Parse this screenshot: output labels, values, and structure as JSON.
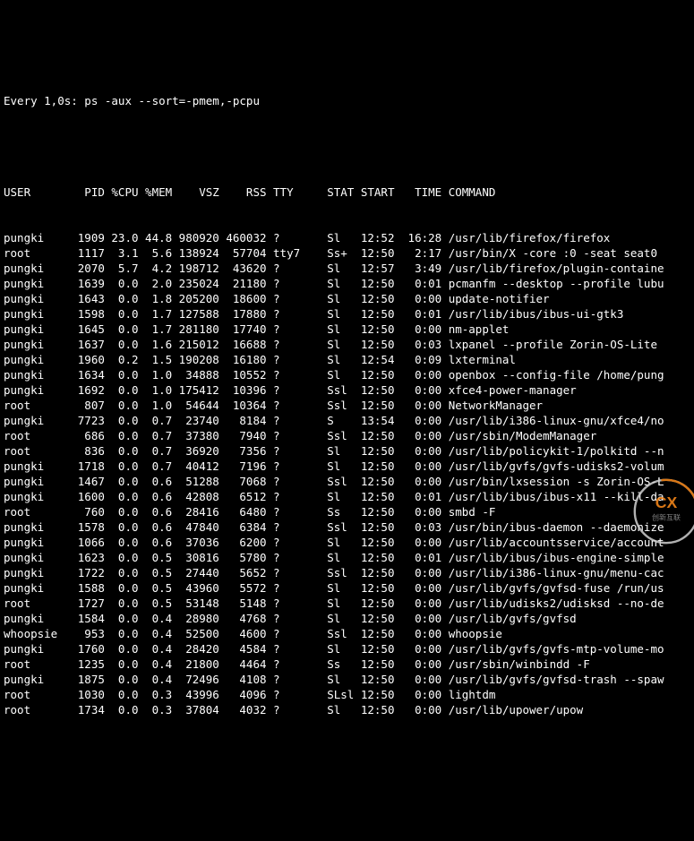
{
  "header_line": "Every 1,0s: ps -aux --sort=-pmem,-pcpu",
  "columns": [
    "USER",
    "PID",
    "%CPU",
    "%MEM",
    "VSZ",
    "RSS",
    "TTY",
    "STAT",
    "START",
    "TIME",
    "COMMAND"
  ],
  "rows": [
    {
      "user": "pungki",
      "pid": "1909",
      "cpu": "23.0",
      "mem": "44.8",
      "vsz": "980920",
      "rss": "460032",
      "tty": "?",
      "stat": "Sl",
      "start": "12:52",
      "time": "16:28",
      "cmd": "/usr/lib/firefox/firefox"
    },
    {
      "user": "root",
      "pid": "1117",
      "cpu": "3.1",
      "mem": "5.6",
      "vsz": "138924",
      "rss": "57704",
      "tty": "tty7",
      "stat": "Ss+",
      "start": "12:50",
      "time": "2:17",
      "cmd": "/usr/bin/X -core :0 -seat seat0"
    },
    {
      "user": "pungki",
      "pid": "2070",
      "cpu": "5.7",
      "mem": "4.2",
      "vsz": "198712",
      "rss": "43620",
      "tty": "?",
      "stat": "Sl",
      "start": "12:57",
      "time": "3:49",
      "cmd": "/usr/lib/firefox/plugin-containe"
    },
    {
      "user": "pungki",
      "pid": "1639",
      "cpu": "0.0",
      "mem": "2.0",
      "vsz": "235024",
      "rss": "21180",
      "tty": "?",
      "stat": "Sl",
      "start": "12:50",
      "time": "0:01",
      "cmd": "pcmanfm --desktop --profile lubu"
    },
    {
      "user": "pungki",
      "pid": "1643",
      "cpu": "0.0",
      "mem": "1.8",
      "vsz": "205200",
      "rss": "18600",
      "tty": "?",
      "stat": "Sl",
      "start": "12:50",
      "time": "0:00",
      "cmd": "update-notifier"
    },
    {
      "user": "pungki",
      "pid": "1598",
      "cpu": "0.0",
      "mem": "1.7",
      "vsz": "127588",
      "rss": "17880",
      "tty": "?",
      "stat": "Sl",
      "start": "12:50",
      "time": "0:01",
      "cmd": "/usr/lib/ibus/ibus-ui-gtk3"
    },
    {
      "user": "pungki",
      "pid": "1645",
      "cpu": "0.0",
      "mem": "1.7",
      "vsz": "281180",
      "rss": "17740",
      "tty": "?",
      "stat": "Sl",
      "start": "12:50",
      "time": "0:00",
      "cmd": "nm-applet"
    },
    {
      "user": "pungki",
      "pid": "1637",
      "cpu": "0.0",
      "mem": "1.6",
      "vsz": "215012",
      "rss": "16688",
      "tty": "?",
      "stat": "Sl",
      "start": "12:50",
      "time": "0:03",
      "cmd": "lxpanel --profile Zorin-OS-Lite"
    },
    {
      "user": "pungki",
      "pid": "1960",
      "cpu": "0.2",
      "mem": "1.5",
      "vsz": "190208",
      "rss": "16180",
      "tty": "?",
      "stat": "Sl",
      "start": "12:54",
      "time": "0:09",
      "cmd": "lxterminal"
    },
    {
      "user": "pungki",
      "pid": "1634",
      "cpu": "0.0",
      "mem": "1.0",
      "vsz": "34888",
      "rss": "10552",
      "tty": "?",
      "stat": "Sl",
      "start": "12:50",
      "time": "0:00",
      "cmd": "openbox --config-file /home/pung"
    },
    {
      "user": "pungki",
      "pid": "1692",
      "cpu": "0.0",
      "mem": "1.0",
      "vsz": "175412",
      "rss": "10396",
      "tty": "?",
      "stat": "Ssl",
      "start": "12:50",
      "time": "0:00",
      "cmd": "xfce4-power-manager"
    },
    {
      "user": "root",
      "pid": "807",
      "cpu": "0.0",
      "mem": "1.0",
      "vsz": "54644",
      "rss": "10364",
      "tty": "?",
      "stat": "Ssl",
      "start": "12:50",
      "time": "0:00",
      "cmd": "NetworkManager"
    },
    {
      "user": "pungki",
      "pid": "7723",
      "cpu": "0.0",
      "mem": "0.7",
      "vsz": "23740",
      "rss": "8184",
      "tty": "?",
      "stat": "S",
      "start": "13:54",
      "time": "0:00",
      "cmd": "/usr/lib/i386-linux-gnu/xfce4/no"
    },
    {
      "user": "root",
      "pid": "686",
      "cpu": "0.0",
      "mem": "0.7",
      "vsz": "37380",
      "rss": "7940",
      "tty": "?",
      "stat": "Ssl",
      "start": "12:50",
      "time": "0:00",
      "cmd": "/usr/sbin/ModemManager"
    },
    {
      "user": "root",
      "pid": "836",
      "cpu": "0.0",
      "mem": "0.7",
      "vsz": "36920",
      "rss": "7356",
      "tty": "?",
      "stat": "Sl",
      "start": "12:50",
      "time": "0:00",
      "cmd": "/usr/lib/policykit-1/polkitd --n"
    },
    {
      "user": "pungki",
      "pid": "1718",
      "cpu": "0.0",
      "mem": "0.7",
      "vsz": "40412",
      "rss": "7196",
      "tty": "?",
      "stat": "Sl",
      "start": "12:50",
      "time": "0:00",
      "cmd": "/usr/lib/gvfs/gvfs-udisks2-volum"
    },
    {
      "user": "pungki",
      "pid": "1467",
      "cpu": "0.0",
      "mem": "0.6",
      "vsz": "51288",
      "rss": "7068",
      "tty": "?",
      "stat": "Ssl",
      "start": "12:50",
      "time": "0:00",
      "cmd": "/usr/bin/lxsession -s Zorin-OS-L"
    },
    {
      "user": "pungki",
      "pid": "1600",
      "cpu": "0.0",
      "mem": "0.6",
      "vsz": "42808",
      "rss": "6512",
      "tty": "?",
      "stat": "Sl",
      "start": "12:50",
      "time": "0:01",
      "cmd": "/usr/lib/ibus/ibus-x11 --kill-da"
    },
    {
      "user": "root",
      "pid": "760",
      "cpu": "0.0",
      "mem": "0.6",
      "vsz": "28416",
      "rss": "6480",
      "tty": "?",
      "stat": "Ss",
      "start": "12:50",
      "time": "0:00",
      "cmd": "smbd -F"
    },
    {
      "user": "pungki",
      "pid": "1578",
      "cpu": "0.0",
      "mem": "0.6",
      "vsz": "47840",
      "rss": "6384",
      "tty": "?",
      "stat": "Ssl",
      "start": "12:50",
      "time": "0:03",
      "cmd": "/usr/bin/ibus-daemon --daemonize"
    },
    {
      "user": "pungki",
      "pid": "1066",
      "cpu": "0.0",
      "mem": "0.6",
      "vsz": "37036",
      "rss": "6200",
      "tty": "?",
      "stat": "Sl",
      "start": "12:50",
      "time": "0:00",
      "cmd": "/usr/lib/accountsservice/account"
    },
    {
      "user": "pungki",
      "pid": "1623",
      "cpu": "0.0",
      "mem": "0.5",
      "vsz": "30816",
      "rss": "5780",
      "tty": "?",
      "stat": "Sl",
      "start": "12:50",
      "time": "0:01",
      "cmd": "/usr/lib/ibus/ibus-engine-simple"
    },
    {
      "user": "pungki",
      "pid": "1722",
      "cpu": "0.0",
      "mem": "0.5",
      "vsz": "27440",
      "rss": "5652",
      "tty": "?",
      "stat": "Ssl",
      "start": "12:50",
      "time": "0:00",
      "cmd": "/usr/lib/i386-linux-gnu/menu-cac"
    },
    {
      "user": "pungki",
      "pid": "1588",
      "cpu": "0.0",
      "mem": "0.5",
      "vsz": "43960",
      "rss": "5572",
      "tty": "?",
      "stat": "Sl",
      "start": "12:50",
      "time": "0:00",
      "cmd": "/usr/lib/gvfs/gvfsd-fuse /run/us"
    },
    {
      "user": "root",
      "pid": "1727",
      "cpu": "0.0",
      "mem": "0.5",
      "vsz": "53148",
      "rss": "5148",
      "tty": "?",
      "stat": "Sl",
      "start": "12:50",
      "time": "0:00",
      "cmd": "/usr/lib/udisks2/udisksd --no-de"
    },
    {
      "user": "pungki",
      "pid": "1584",
      "cpu": "0.0",
      "mem": "0.4",
      "vsz": "28980",
      "rss": "4768",
      "tty": "?",
      "stat": "Sl",
      "start": "12:50",
      "time": "0:00",
      "cmd": "/usr/lib/gvfs/gvfsd"
    },
    {
      "user": "whoopsie",
      "pid": "953",
      "cpu": "0.0",
      "mem": "0.4",
      "vsz": "52500",
      "rss": "4600",
      "tty": "?",
      "stat": "Ssl",
      "start": "12:50",
      "time": "0:00",
      "cmd": "whoopsie"
    },
    {
      "user": "pungki",
      "pid": "1760",
      "cpu": "0.0",
      "mem": "0.4",
      "vsz": "28420",
      "rss": "4584",
      "tty": "?",
      "stat": "Sl",
      "start": "12:50",
      "time": "0:00",
      "cmd": "/usr/lib/gvfs/gvfs-mtp-volume-mo"
    },
    {
      "user": "root",
      "pid": "1235",
      "cpu": "0.0",
      "mem": "0.4",
      "vsz": "21800",
      "rss": "4464",
      "tty": "?",
      "stat": "Ss",
      "start": "12:50",
      "time": "0:00",
      "cmd": "/usr/sbin/winbindd -F"
    },
    {
      "user": "pungki",
      "pid": "1875",
      "cpu": "0.0",
      "mem": "0.4",
      "vsz": "72496",
      "rss": "4108",
      "tty": "?",
      "stat": "Sl",
      "start": "12:50",
      "time": "0:00",
      "cmd": "/usr/lib/gvfs/gvfsd-trash --spaw"
    },
    {
      "user": "root",
      "pid": "1030",
      "cpu": "0.0",
      "mem": "0.3",
      "vsz": "43996",
      "rss": "4096",
      "tty": "?",
      "stat": "SLsl",
      "start": "12:50",
      "time": "0:00",
      "cmd": "lightdm"
    },
    {
      "user": "root",
      "pid": "1734",
      "cpu": "0.0",
      "mem": "0.3",
      "vsz": "37804",
      "rss": "4032",
      "tty": "?",
      "stat": "Sl",
      "start": "12:50",
      "time": "0:00",
      "cmd": "/usr/lib/upower/upow"
    }
  ],
  "colwidths": {
    "user": 8,
    "pid": 7,
    "cpu": 5,
    "mem": 5,
    "vsz": 7,
    "rss": 7,
    "tty": 6,
    "stat": 5,
    "start": 6,
    "time": 6
  }
}
